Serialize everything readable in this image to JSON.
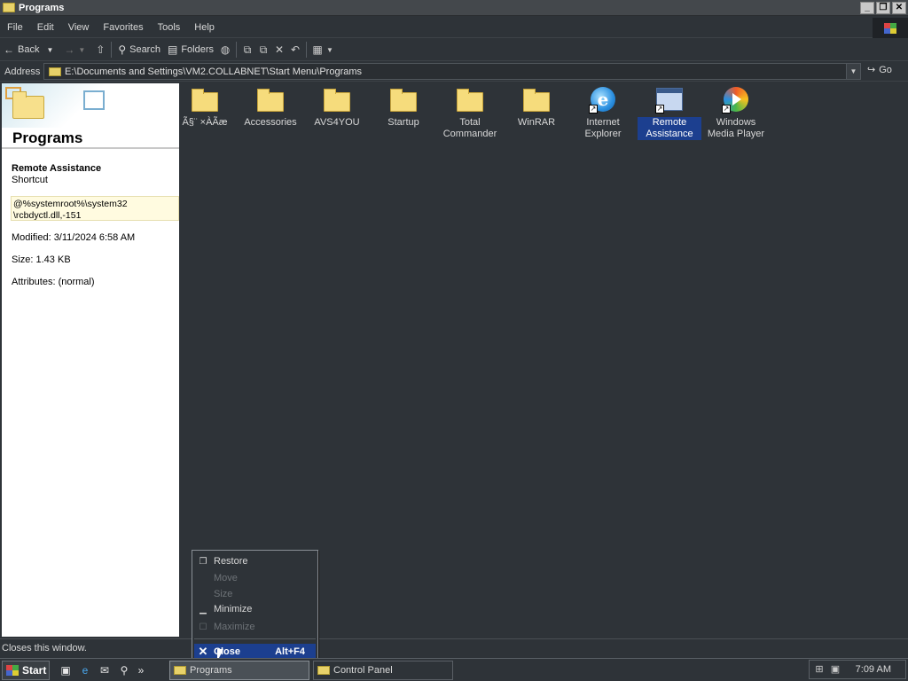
{
  "window": {
    "title": "Programs",
    "controls": [
      "minimize",
      "restore",
      "close"
    ]
  },
  "menu": [
    "File",
    "Edit",
    "View",
    "Favorites",
    "Tools",
    "Help"
  ],
  "toolbar": {
    "back": "Back",
    "search": "Search",
    "folders": "Folders"
  },
  "address": {
    "label": "Address",
    "path": "E:\\Documents and Settings\\VM2.COLLABNET\\Start Menu\\Programs",
    "go": "Go"
  },
  "infopane": {
    "title": "Programs",
    "item_name": "Remote Assistance",
    "item_type": "Shortcut",
    "target_line1": "@%systemroot%\\system32",
    "target_line2": "\\rcbdyctl.dll,-151",
    "modified": "Modified: 3/11/2024 6:58 AM",
    "size": "Size: 1.43 KB",
    "attributes": "Attributes: (normal)"
  },
  "items": [
    {
      "label": "Ã§¨ ×ÀÃæ",
      "icon": "folder-icon"
    },
    {
      "label": "Accessories",
      "icon": "folder-icon"
    },
    {
      "label": "AVS4YOU",
      "icon": "folder-icon"
    },
    {
      "label": "Startup",
      "icon": "folder-icon"
    },
    {
      "label": "Total Commander",
      "icon": "folder-icon"
    },
    {
      "label": "WinRAR",
      "icon": "folder-icon"
    },
    {
      "label": "Internet Explorer",
      "icon": "internet-explorer-icon"
    },
    {
      "label": "Remote Assistance",
      "icon": "remote-assistance-icon",
      "selected": true
    },
    {
      "label": "Windows Media Player",
      "icon": "media-player-icon"
    }
  ],
  "status": "Closes this window.",
  "context_menu": {
    "restore": "Restore",
    "move": "Move",
    "size": "Size",
    "minimize": "Minimize",
    "maximize": "Maximize",
    "close": "Close",
    "close_shortcut": "Alt+F4"
  },
  "taskbar": {
    "start": "Start",
    "tasks": [
      "Programs",
      "Control Panel"
    ],
    "clock": "7:09 AM"
  },
  "colors": {
    "selection": "#1c3f8f",
    "background": "#2e3338",
    "titlebar": "#44484c"
  }
}
